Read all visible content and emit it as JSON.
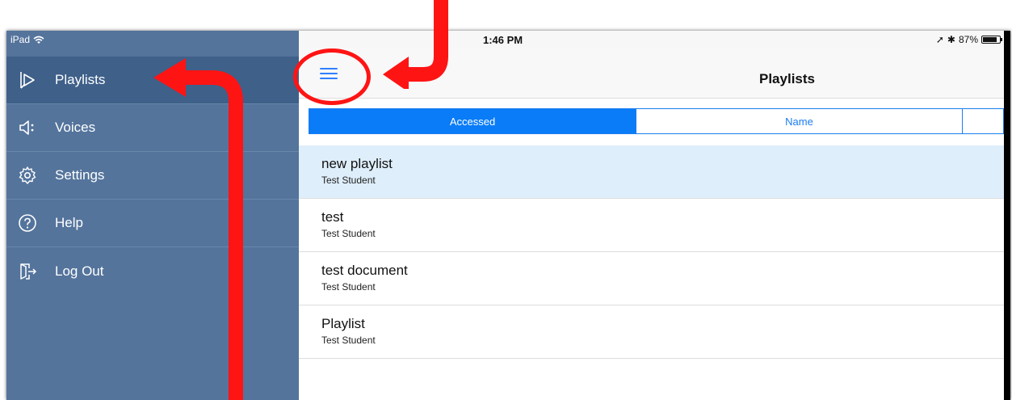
{
  "status": {
    "device": "iPad",
    "time": "1:46 PM",
    "battery": "87%",
    "battery_level": 0.87
  },
  "sidebar": {
    "items": [
      {
        "label": "Playlists",
        "icon": "playlist-icon",
        "active": true
      },
      {
        "label": "Voices",
        "icon": "voices-icon",
        "active": false
      },
      {
        "label": "Settings",
        "icon": "gear-icon",
        "active": false
      },
      {
        "label": "Help",
        "icon": "help-icon",
        "active": false
      },
      {
        "label": "Log Out",
        "icon": "logout-icon",
        "active": false
      }
    ]
  },
  "header": {
    "title": "Playlists",
    "menu_icon": "hamburger-icon"
  },
  "sort_tabs": [
    {
      "label": "Accessed",
      "active": true
    },
    {
      "label": "Name",
      "active": false
    },
    {
      "label": "",
      "active": false
    }
  ],
  "playlists": [
    {
      "title": "new playlist",
      "owner": "Test Student",
      "selected": true
    },
    {
      "title": "test",
      "owner": "Test Student",
      "selected": false
    },
    {
      "title": "test document",
      "owner": "Test Student",
      "selected": false
    },
    {
      "title": "Playlist",
      "owner": "Test Student",
      "selected": false
    }
  ],
  "colors": {
    "sidebar_bg": "#54749c",
    "sidebar_active": "#3e6089",
    "accent": "#0a7cf7",
    "annotation": "#ff1414",
    "selected_row": "#deeefa"
  }
}
